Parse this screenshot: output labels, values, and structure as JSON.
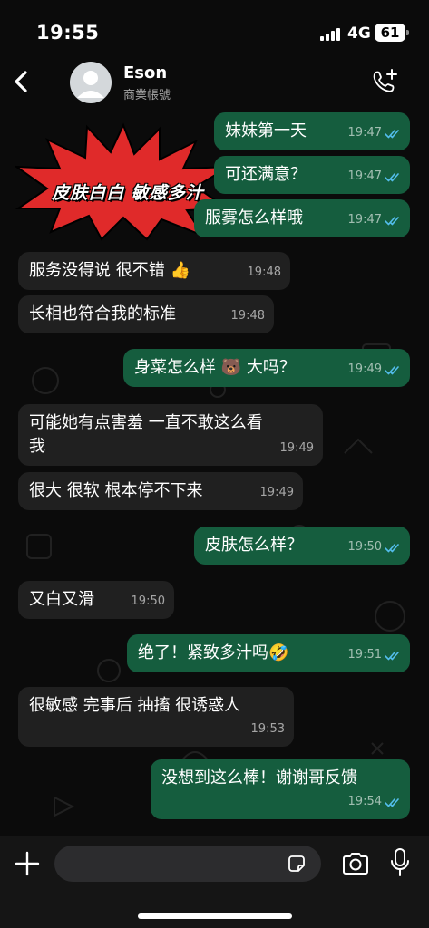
{
  "status_bar": {
    "time": "19:55",
    "network": "4G",
    "battery": "61"
  },
  "header": {
    "back_icon": "chevron-left-icon",
    "contact_name": "Eson",
    "contact_subtitle": "商業帳號",
    "call_icon": "add-call-icon"
  },
  "sticker": {
    "text": "皮肤白白 敏感多汁",
    "color": "#e02020"
  },
  "messages": [
    {
      "dir": "out",
      "text": "妹妹第一天",
      "time": "19:47",
      "read": true
    },
    {
      "dir": "out",
      "text": "可还满意？",
      "time": "19:47",
      "read": true
    },
    {
      "dir": "out",
      "text": "服雾怎么样哦",
      "time": "19:47",
      "read": true
    },
    {
      "dir": "in",
      "text": "服务没得说 很不错 👍",
      "time": "19:48"
    },
    {
      "dir": "in",
      "text": "长相也符合我的标准",
      "time": "19:48"
    },
    {
      "dir": "out",
      "text": "身菜怎么样 🐻 大吗？",
      "time": "19:49",
      "read": true
    },
    {
      "dir": "in",
      "text": "可能她有点害羞 一直不敢这么看\n我",
      "time": "19:49"
    },
    {
      "dir": "in",
      "text": "很大 很软 根本停不下来",
      "time": "19:49"
    },
    {
      "dir": "out",
      "text": "皮肤怎么样？",
      "time": "19:50",
      "read": true
    },
    {
      "dir": "in",
      "text": "又白又滑",
      "time": "19:50"
    },
    {
      "dir": "out",
      "text": "绝了！紧致多汁吗🤣",
      "time": "19:51",
      "read": true
    },
    {
      "dir": "in",
      "text": "很敏感 完事后 抽搐 很诱惑人",
      "time": "19:53"
    },
    {
      "dir": "out",
      "text": "没想到这么棒！谢谢哥反馈",
      "time": "19:54",
      "read": true
    }
  ],
  "composer": {
    "plus_icon": "plus-icon",
    "placeholder": "",
    "sticker_icon": "sticker-icon",
    "camera_icon": "camera-icon",
    "mic_icon": "microphone-icon"
  },
  "colors": {
    "incoming_bubble": "#202020",
    "outgoing_bubble": "#155d3e",
    "read_ticks": "#53bdeb",
    "background": "#0b0b0b"
  }
}
